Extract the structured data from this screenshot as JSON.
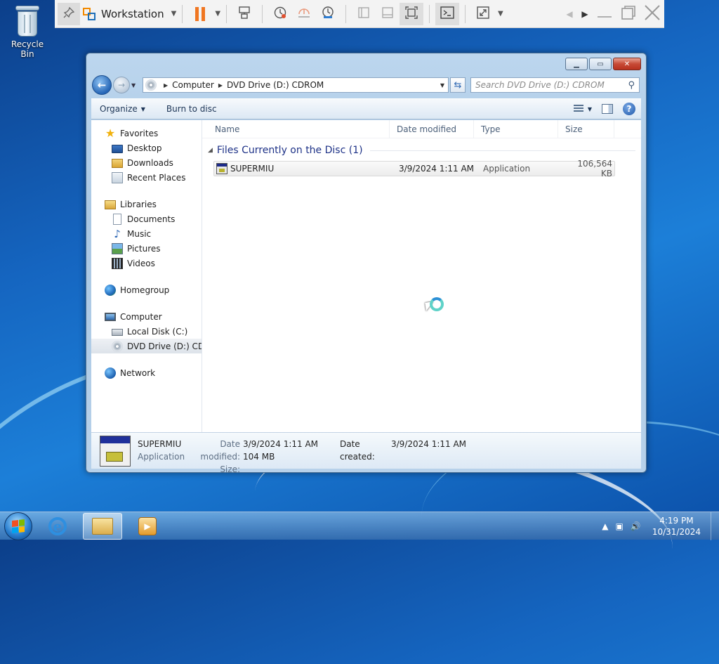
{
  "desktop": {
    "recycle_bin_label": "Recycle Bin"
  },
  "vmware": {
    "title": "Workstation",
    "pause_color": "#f07621",
    "icons": [
      "pin-icon",
      "vmware-logo-icon",
      "pause-icon",
      "send-ctrl-alt-del-icon",
      "snapshot-icon",
      "revert-snapshot-icon",
      "snapshot-manager-icon",
      "sidebar-view-icon",
      "thumbnail-view-icon",
      "fit-guest-icon",
      "console-view-icon",
      "fullscreen-icon",
      "minimize-icon",
      "restore-icon",
      "close-icon"
    ]
  },
  "explorer": {
    "address": {
      "crumbs": [
        "Computer",
        "DVD Drive (D:) CDROM"
      ]
    },
    "search": {
      "placeholder": "Search DVD Drive (D:) CDROM"
    },
    "commands": {
      "organize": "Organize",
      "burn": "Burn to disc"
    },
    "nav": {
      "favorites": {
        "label": "Favorites",
        "items": [
          "Desktop",
          "Downloads",
          "Recent Places"
        ]
      },
      "libraries": {
        "label": "Libraries",
        "items": [
          "Documents",
          "Music",
          "Pictures",
          "Videos"
        ]
      },
      "homegroup": {
        "label": "Homegroup"
      },
      "computer": {
        "label": "Computer",
        "items": [
          "Local Disk (C:)",
          "DVD Drive (D:) CDROM"
        ]
      },
      "network": {
        "label": "Network"
      }
    },
    "columns": {
      "name": "Name",
      "date": "Date modified",
      "type": "Type",
      "size": "Size"
    },
    "group": {
      "title": "Files Currently on the Disc (1)"
    },
    "files": [
      {
        "name": "SUPERMIU",
        "date": "3/9/2024 1:11 AM",
        "type": "Application",
        "size": "106,564 KB"
      }
    ],
    "details": {
      "name": "SUPERMIU",
      "type": "Application",
      "modified_label": "Date modified:",
      "modified_value": "3/9/2024 1:11 AM",
      "size_label": "Size:",
      "size_value": "104 MB",
      "created_label": "Date created:",
      "created_value": "3/9/2024 1:11 AM"
    }
  },
  "taskbar": {
    "time": "4:19 PM",
    "date": "10/31/2024",
    "tray_icons": [
      "show-hidden-icons-icon",
      "network-icon",
      "volume-icon"
    ]
  }
}
